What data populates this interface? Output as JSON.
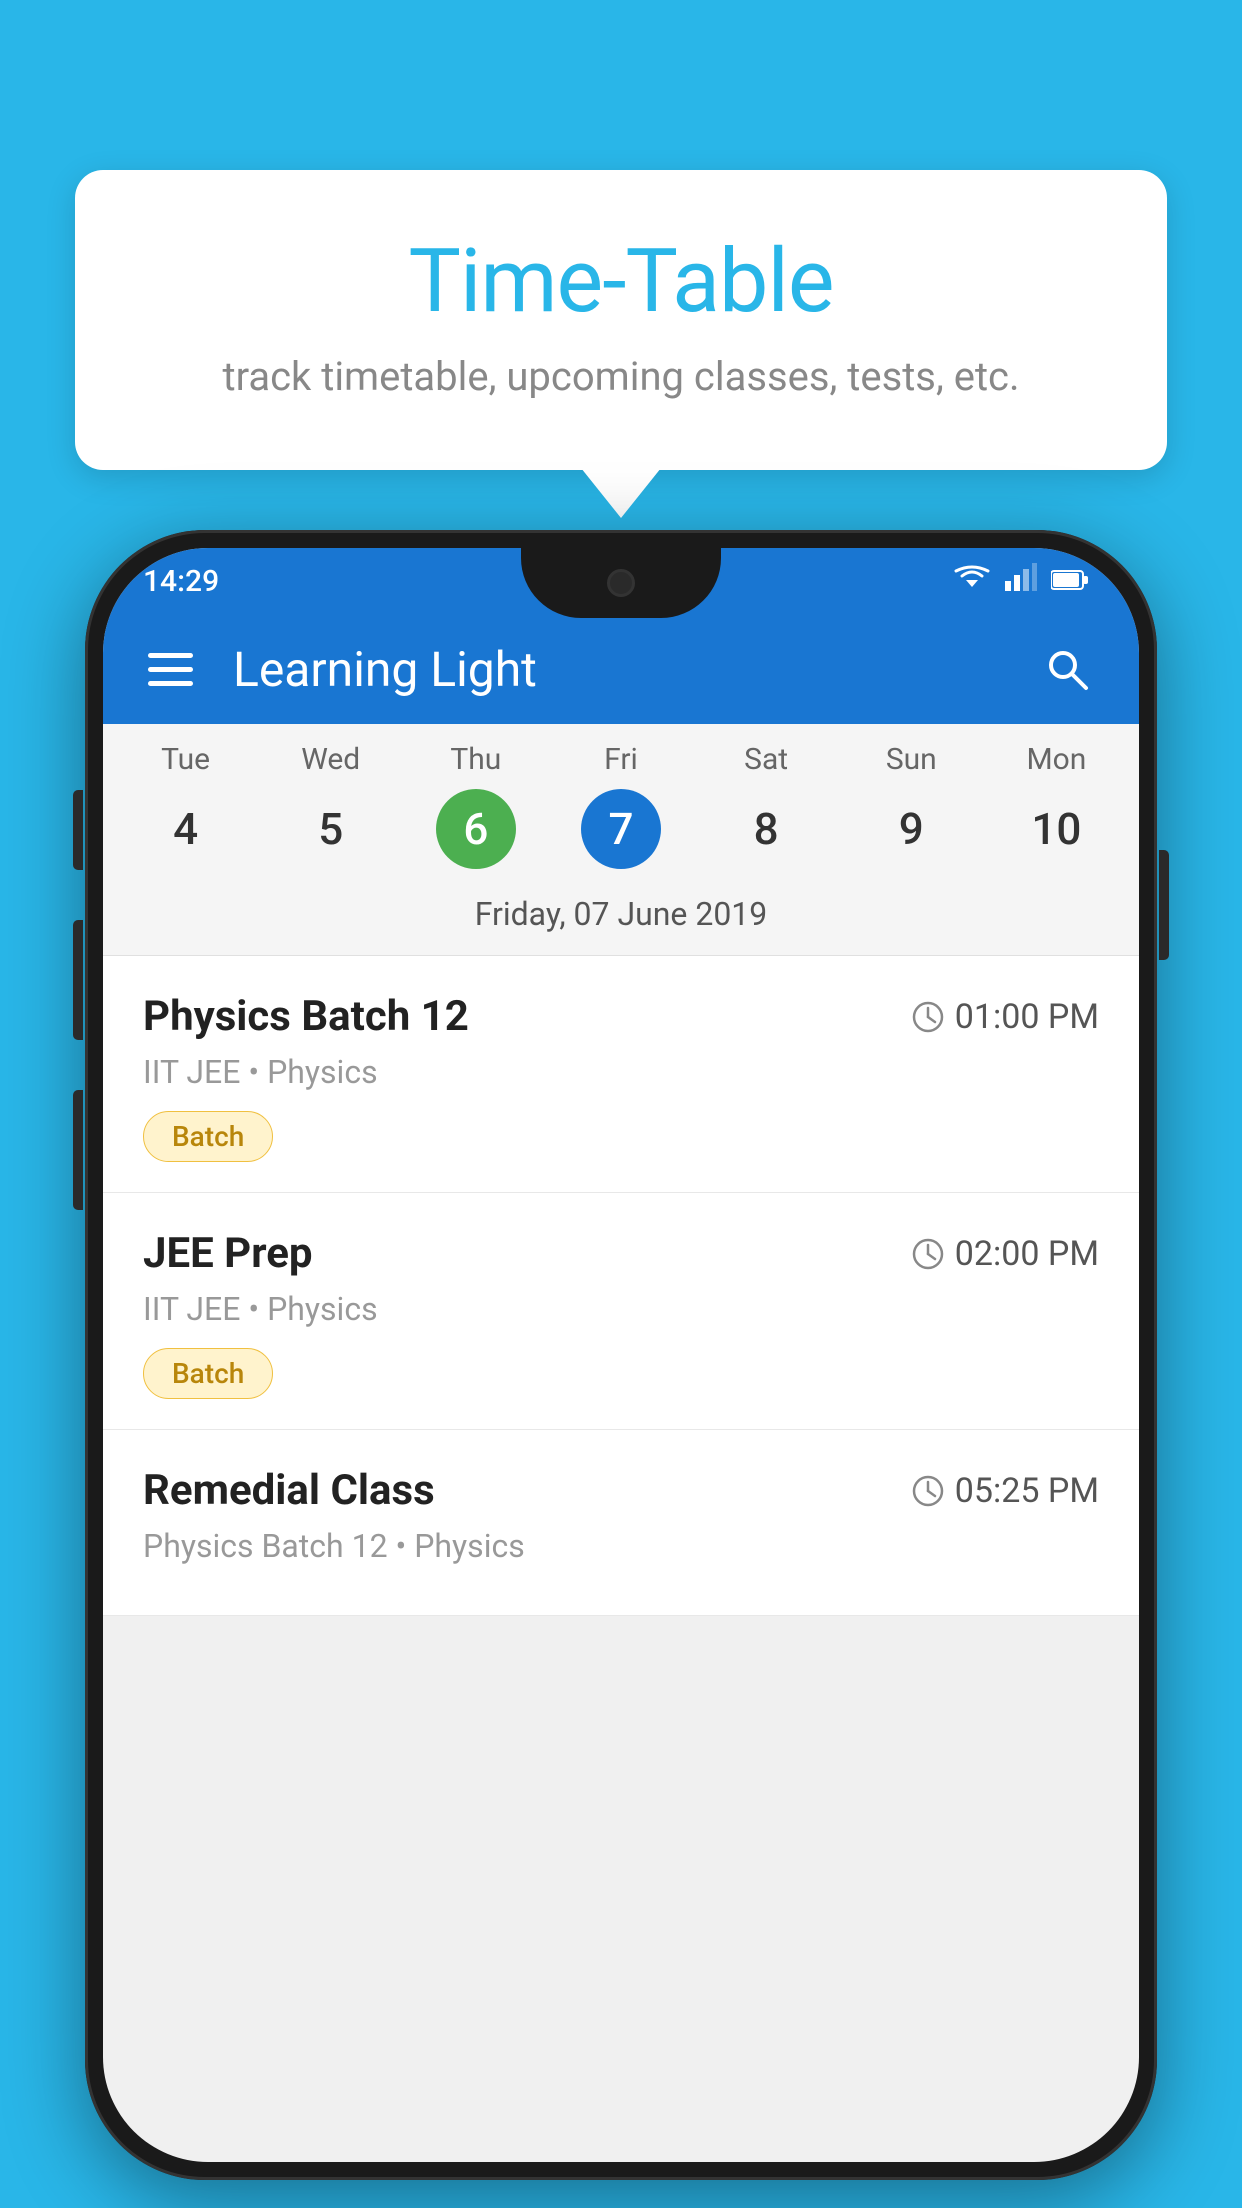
{
  "background": {
    "color": "#29B6E8"
  },
  "speech_bubble": {
    "title": "Time-Table",
    "subtitle": "track timetable, upcoming classes, tests, etc."
  },
  "phone": {
    "status_bar": {
      "time": "14:29"
    },
    "app_bar": {
      "title": "Learning Light",
      "menu_icon_label": "menu",
      "search_icon_label": "search"
    },
    "calendar": {
      "days": [
        {
          "name": "Tue",
          "num": "4"
        },
        {
          "name": "Wed",
          "num": "5"
        },
        {
          "name": "Thu",
          "num": "6",
          "state": "today"
        },
        {
          "name": "Fri",
          "num": "7",
          "state": "selected"
        },
        {
          "name": "Sat",
          "num": "8"
        },
        {
          "name": "Sun",
          "num": "9"
        },
        {
          "name": "Mon",
          "num": "10"
        }
      ],
      "selected_date": "Friday, 07 June 2019"
    },
    "schedule": [
      {
        "title": "Physics Batch 12",
        "time": "01:00 PM",
        "subtitle": "IIT JEE • Physics",
        "badge": "Batch"
      },
      {
        "title": "JEE Prep",
        "time": "02:00 PM",
        "subtitle": "IIT JEE • Physics",
        "badge": "Batch"
      },
      {
        "title": "Remedial Class",
        "time": "05:25 PM",
        "subtitle": "Physics Batch 12 • Physics",
        "badge": null
      }
    ]
  }
}
